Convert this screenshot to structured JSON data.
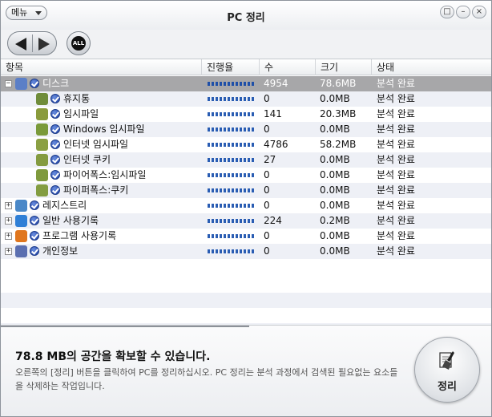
{
  "window": {
    "title": "PC 정리",
    "menu_label": "메뉴",
    "controls": [
      "□",
      "–",
      "×"
    ]
  },
  "toolbar": {
    "all_label": "ALL"
  },
  "columns": [
    "항목",
    "진행율",
    "수",
    "크기",
    "상태"
  ],
  "rows": [
    {
      "name": "디스크",
      "level": 0,
      "expander": "−",
      "count": "4954",
      "size": "78.6MB",
      "status": "분석 완료",
      "icon": "computer-disk-icon",
      "selected": true
    },
    {
      "name": "휴지통",
      "level": 1,
      "count": "0",
      "size": "0.0MB",
      "status": "분석 완료",
      "icon": "recycle-bin-icon"
    },
    {
      "name": "임시파일",
      "level": 1,
      "count": "141",
      "size": "20.3MB",
      "status": "분석 완료",
      "icon": "temp-file-icon"
    },
    {
      "name": "Windows 임시파일",
      "level": 1,
      "count": "0",
      "size": "0.0MB",
      "status": "분석 완료",
      "icon": "windows-temp-icon"
    },
    {
      "name": "인터넷 임시파일",
      "level": 1,
      "count": "4786",
      "size": "58.2MB",
      "status": "분석 완료",
      "icon": "internet-temp-icon"
    },
    {
      "name": "인터넷 쿠키",
      "level": 1,
      "count": "27",
      "size": "0.0MB",
      "status": "분석 완료",
      "icon": "cookie-icon"
    },
    {
      "name": "파이어폭스:임시파일",
      "level": 1,
      "count": "0",
      "size": "0.0MB",
      "status": "분석 완료",
      "icon": "firefox-temp-icon"
    },
    {
      "name": "파이퍼폭스:쿠키",
      "level": 1,
      "count": "0",
      "size": "0.0MB",
      "status": "분석 완료",
      "icon": "firefox-cookie-icon"
    },
    {
      "name": "레지스트리",
      "level": 0,
      "expander": "+",
      "count": "0",
      "size": "0.0MB",
      "status": "분석 완료",
      "icon": "registry-icon"
    },
    {
      "name": "일반 사용기록",
      "level": 0,
      "expander": "+",
      "count": "224",
      "size": "0.2MB",
      "status": "분석 완료",
      "icon": "internet-explorer-icon"
    },
    {
      "name": "프로그램 사용기록",
      "level": 0,
      "expander": "+",
      "count": "0",
      "size": "0.0MB",
      "status": "분석 완료",
      "icon": "firefox-icon"
    },
    {
      "name": "개인정보",
      "level": 0,
      "expander": "+",
      "count": "0",
      "size": "0.0MB",
      "status": "분석 완료",
      "icon": "personal-info-icon"
    }
  ],
  "footer": {
    "headline": "78.8 MB의 공간을 확보할 수 있습니다.",
    "description": "오른쪽의 [정리] 버튼을 클릭하여 PC를 정리하십시오. PC 정리는 분석 과정에서 검색된 필요없는 요소들을 삭제하는 작업입니다.",
    "clean_button": "정리"
  },
  "colors": {
    "progress": "#2a5db3",
    "selected_row": "#a7a7a9",
    "alt_row": "#eef0f6"
  }
}
